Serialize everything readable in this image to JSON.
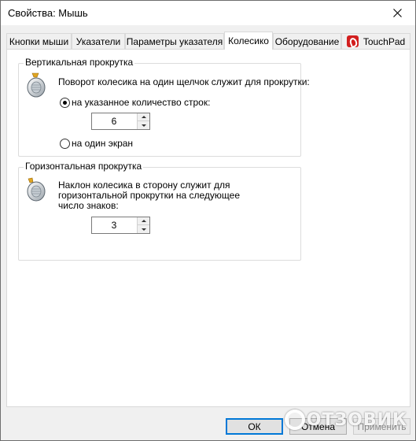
{
  "window": {
    "title": "Свойства: Мышь"
  },
  "tabs": [
    {
      "label": "Кнопки мыши",
      "active": false
    },
    {
      "label": "Указатели",
      "active": false
    },
    {
      "label": "Параметры указателя",
      "active": false
    },
    {
      "label": "Колесико",
      "active": true
    },
    {
      "label": "Оборудование",
      "active": false
    },
    {
      "label": "TouchPad",
      "active": false,
      "icon": "touchpad-logo-icon"
    }
  ],
  "vertical": {
    "legend": "Вертикальная прокрутка",
    "description": "Поворот колесика на один щелчок служит для прокрутки:",
    "option_lines": "на указанное количество строк:",
    "lines_value": "6",
    "option_screen": "на один экран",
    "selected": "lines"
  },
  "horizontal": {
    "legend": "Горизонтальная прокрутка",
    "description_lines": [
      "Наклон колесика в сторону служит для",
      "горизонтальной прокрутки на следующее",
      "число знаков:"
    ],
    "chars_value": "3"
  },
  "buttons": {
    "ok": "ОК",
    "cancel": "Отмена",
    "apply": "Применить"
  },
  "watermark": {
    "text": "ОТЗОВИК"
  },
  "colors": {
    "accent": "#0078d7",
    "touchpad_brand": "#d21e1e"
  }
}
